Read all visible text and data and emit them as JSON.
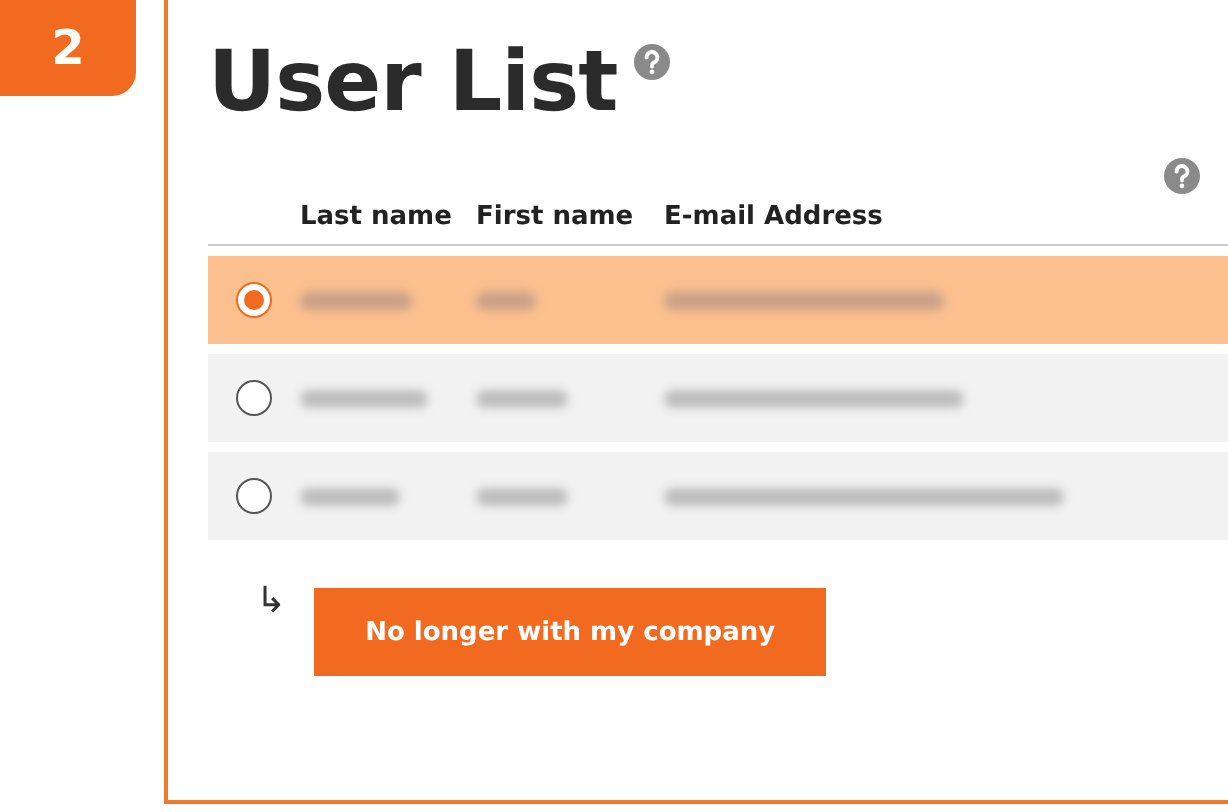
{
  "step_badge": "2",
  "title": "User List",
  "table": {
    "columns": [
      "Last name",
      "First name",
      "E-mail Address"
    ],
    "rows": [
      {
        "selected": true
      },
      {
        "selected": false
      },
      {
        "selected": false
      }
    ]
  },
  "connector": "↳",
  "action_button": "No longer with my company"
}
